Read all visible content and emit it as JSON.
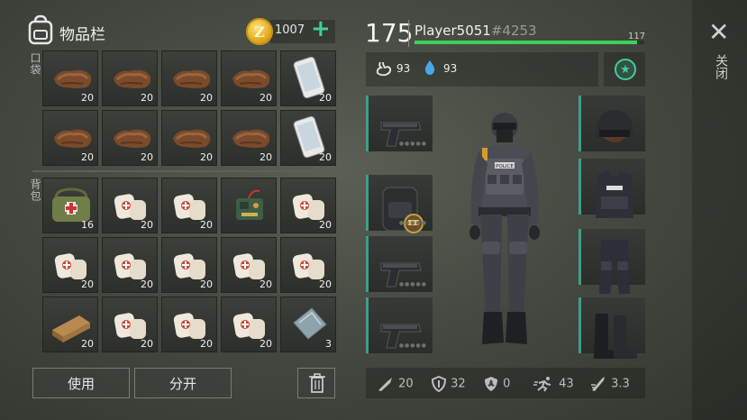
{
  "header": {
    "title": "物品栏",
    "coins": "1007",
    "coin_symbol": "Z"
  },
  "sections": {
    "pockets_label": "口袋",
    "backpack_label": "背包"
  },
  "pockets": [
    {
      "item": "leather",
      "count": "20"
    },
    {
      "item": "leather",
      "count": "20"
    },
    {
      "item": "leather",
      "count": "20"
    },
    {
      "item": "leather",
      "count": "20"
    },
    {
      "item": "phone",
      "count": "20"
    },
    {
      "item": "leather",
      "count": "20"
    },
    {
      "item": "leather",
      "count": "20"
    },
    {
      "item": "leather",
      "count": "20"
    },
    {
      "item": "leather",
      "count": "20"
    },
    {
      "item": "phone",
      "count": "20"
    }
  ],
  "backpack": [
    {
      "item": "medkit-bag",
      "count": "16"
    },
    {
      "item": "bandage",
      "count": "20"
    },
    {
      "item": "bandage",
      "count": "20"
    },
    {
      "item": "detonator",
      "count": ""
    },
    {
      "item": "bandage",
      "count": "20"
    },
    {
      "item": "bandage",
      "count": "20"
    },
    {
      "item": "bandage",
      "count": "20"
    },
    {
      "item": "bandage",
      "count": "20"
    },
    {
      "item": "bandage",
      "count": "20"
    },
    {
      "item": "bandage",
      "count": "20"
    },
    {
      "item": "wood-plank",
      "count": "20"
    },
    {
      "item": "bandage",
      "count": "20"
    },
    {
      "item": "bandage",
      "count": "20"
    },
    {
      "item": "bandage",
      "count": "20"
    },
    {
      "item": "metal-plate",
      "count": "3"
    }
  ],
  "buttons": {
    "use": "使用",
    "split": "分开"
  },
  "player": {
    "level": "175",
    "name": "Player5051",
    "tag": "#4253",
    "xp_value": "117",
    "xp_fraction": 0.97
  },
  "stats": {
    "food": "93",
    "water": "93"
  },
  "equipment_left": [
    "pistol",
    "backpack",
    "pistol",
    "pistol"
  ],
  "equipment_right": [
    "helmet",
    "vest",
    "pants",
    "boots"
  ],
  "combat_stats": {
    "attack": "20",
    "defense": "32",
    "radiation": "0",
    "speed": "43",
    "stealth": "3.3"
  },
  "close": {
    "label": "关闭"
  },
  "colors": {
    "accent": "#3ecf9a",
    "xp": "#3ed05a",
    "equip_border": "#3e9e8c"
  }
}
